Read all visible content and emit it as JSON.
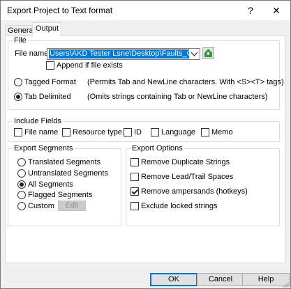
{
  "window": {
    "title": "Export Project to Text format",
    "help_glyph": "?",
    "close_glyph": "✕"
  },
  "tabs": [
    {
      "label": "General",
      "selected": false
    },
    {
      "label": "Output",
      "selected": true
    }
  ],
  "file_group": {
    "title": "File",
    "file_name_label": "File name:",
    "file_name_value": "Users\\AKD Tester Lsne\\Desktop\\Faults_Chinese.txt",
    "append_label": "Append if file exists",
    "append_checked": false,
    "tagged_label": "Tagged Format",
    "tagged_desc": "(Permits Tab and NewLine characters. With <S><T> tags)",
    "tagged_selected": false,
    "tab_label": "Tab Delimited",
    "tab_desc": "(Omits strings containing Tab or NewLine characters)",
    "tab_selected": true
  },
  "include_fields": {
    "title": "Include Fields",
    "items": [
      {
        "label": "File name",
        "checked": false
      },
      {
        "label": "Resource type",
        "checked": false
      },
      {
        "label": "ID",
        "checked": false
      },
      {
        "label": "Language",
        "checked": false
      },
      {
        "label": "Memo",
        "checked": false
      }
    ]
  },
  "export_segments": {
    "title": "Export Segments",
    "options": [
      {
        "label": "Translated Segments",
        "selected": false
      },
      {
        "label": "Untranslated Segments",
        "selected": false
      },
      {
        "label": "All Segments",
        "selected": true
      },
      {
        "label": "Flagged Segments",
        "selected": false
      },
      {
        "label": "Custom",
        "selected": false
      }
    ],
    "edit_label": "Edit"
  },
  "export_options": {
    "title": "Export Options",
    "items": [
      {
        "label": "Remove Duplicate Strings",
        "checked": false
      },
      {
        "label": "Remove Lead/Trail Spaces",
        "checked": false
      },
      {
        "label": "Remove ampersands (hotkeys)",
        "checked": true
      },
      {
        "label": "Exclude locked strings",
        "checked": false
      }
    ]
  },
  "buttons": {
    "ok": "OK",
    "cancel": "Cancel",
    "help": "Help"
  },
  "colors": {
    "selection": "#0078d7",
    "dialog_bg": "#f0f0f0",
    "browse_icon": "#2e9e3a"
  }
}
